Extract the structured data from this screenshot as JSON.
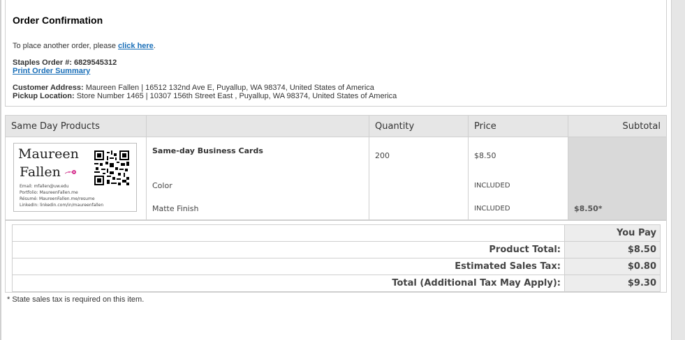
{
  "confirmation": {
    "title": "Order Confirmation",
    "another_order_prefix": "To place another order, please ",
    "another_order_link": "click here",
    "another_order_suffix": ".",
    "order_number_label": "Staples Order #:",
    "order_number": "6829545312",
    "print_link": "Print Order Summary",
    "customer_address_label": "Customer Address:",
    "customer_address": "Maureen Fallen | 16512 132nd Ave E, Puyallup, WA 98374, United States of America",
    "pickup_label": "Pickup Location:",
    "pickup_location": "Store Number 1465 | 10307 156th Street East , Puyallup, WA 98374, United States of America"
  },
  "products_table": {
    "headers": [
      "Same Day Products",
      "",
      "Quantity",
      "Price",
      "Subtotal"
    ],
    "item": {
      "card": {
        "name_line1": "Maureen",
        "name_line2": "Fallen",
        "lines": [
          "Email: mfallen@uw.edu",
          "Portfolio: MaureenFallen.me",
          "Résumé: MaureenFallen.me/resume",
          "LinkedIn: linkedin.com/in/maureenfallen"
        ]
      },
      "name": "Same-day Business Cards",
      "option1": "Color",
      "option2": "Matte Finish",
      "quantity": "200",
      "price": "$8.50",
      "option1_price": "INCLUDED",
      "option2_price": "INCLUDED",
      "subtotal": "$8.50*"
    }
  },
  "totals": {
    "you_pay_label": "You Pay",
    "rows": [
      {
        "label": "Product Total:",
        "value": "$8.50"
      },
      {
        "label": "Estimated Sales Tax:",
        "value": "$0.80"
      },
      {
        "label": "Total (Additional Tax May Apply):",
        "value": "$9.30"
      }
    ]
  },
  "footnote": "* State sales tax is required on this item.",
  "icons": {
    "qr": "qr-code-icon",
    "flower": "flower-icon"
  },
  "colors": {
    "link": "#1a6fb8",
    "header_bg": "#e6e6e6",
    "subtotal_bg": "#d9d9d9"
  }
}
